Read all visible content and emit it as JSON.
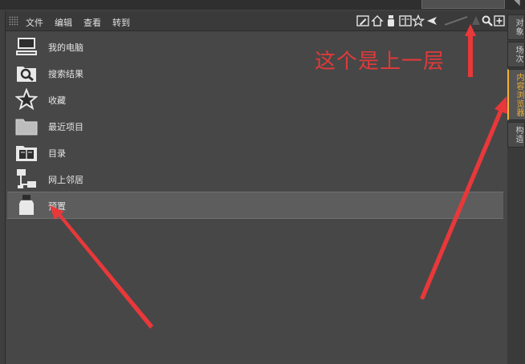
{
  "top_strip": {
    "label": "",
    "dropdown_value": ""
  },
  "menubar": {
    "items": [
      {
        "label": "文件"
      },
      {
        "label": "编辑"
      },
      {
        "label": "查看"
      },
      {
        "label": "转到"
      }
    ]
  },
  "toolbar": {
    "icons": [
      "pencil-icon",
      "home-icon",
      "bottle-icon",
      "book-icon",
      "star-icon",
      "back-arrow-icon",
      "up-arrow-icon",
      "search-icon",
      "plus-box-icon"
    ]
  },
  "list": {
    "items": [
      {
        "label": "我的电脑",
        "icon": "computer-icon"
      },
      {
        "label": "搜索结果",
        "icon": "search-folder-icon"
      },
      {
        "label": "收藏",
        "icon": "star-icon"
      },
      {
        "label": "最近项目",
        "icon": "folder-icon"
      },
      {
        "label": "目录",
        "icon": "book-folder-icon"
      },
      {
        "label": "网上邻居",
        "icon": "network-icon"
      },
      {
        "label": "预置",
        "icon": "bottle-icon",
        "selected": true
      }
    ]
  },
  "right_tabs": [
    {
      "label": "对象"
    },
    {
      "label": "场次"
    },
    {
      "label": "内容浏览器",
      "active": true
    },
    {
      "label": "构造"
    }
  ],
  "annotation": {
    "text": "这个是上一层",
    "color": "#e03a3a"
  },
  "colors": {
    "panel_bg": "#474747",
    "selected_row": "#5d5d5d",
    "accent_tab": "#f2b233"
  }
}
